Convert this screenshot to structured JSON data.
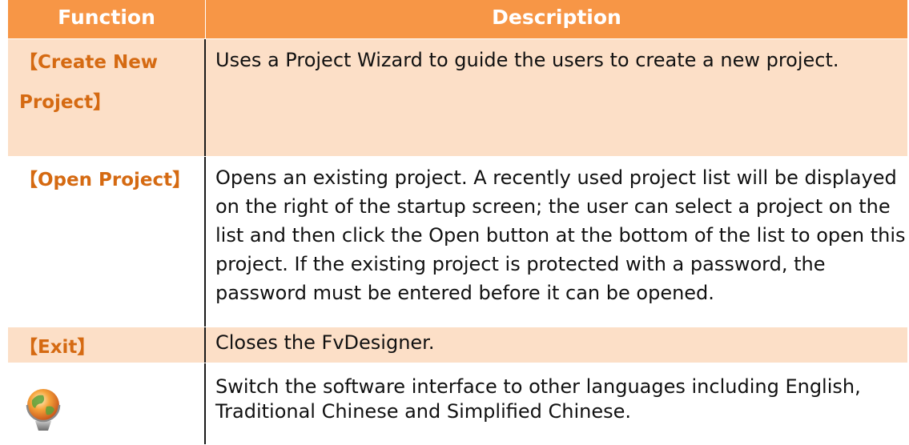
{
  "header": {
    "function_label": "Function",
    "description_label": "Description"
  },
  "rows": [
    {
      "function": "【Create New Project】",
      "function_line1": "【Create New",
      "function_line2": "Project】",
      "description": "Uses a Project Wizard to guide the users to create a new project."
    },
    {
      "function": "【Open Project】",
      "description": "Opens an existing project. A recently used project list will be displayed on the right of the startup screen; the user can select a project on the list and then click the Open button at the bottom of the list to open this project. If the existing project is protected with a password, the password must be entered before it can be opened."
    },
    {
      "function": "【Exit】",
      "description": "Closes the FvDesigner."
    },
    {
      "function_icon": "globe-language-icon",
      "description": "Switch the software interface to other languages including English, Traditional Chinese and Simplified Chinese."
    }
  ],
  "colors": {
    "header_bg": "#f79646",
    "alt_row_bg": "#fcdfc7",
    "function_text": "#d56a12"
  }
}
